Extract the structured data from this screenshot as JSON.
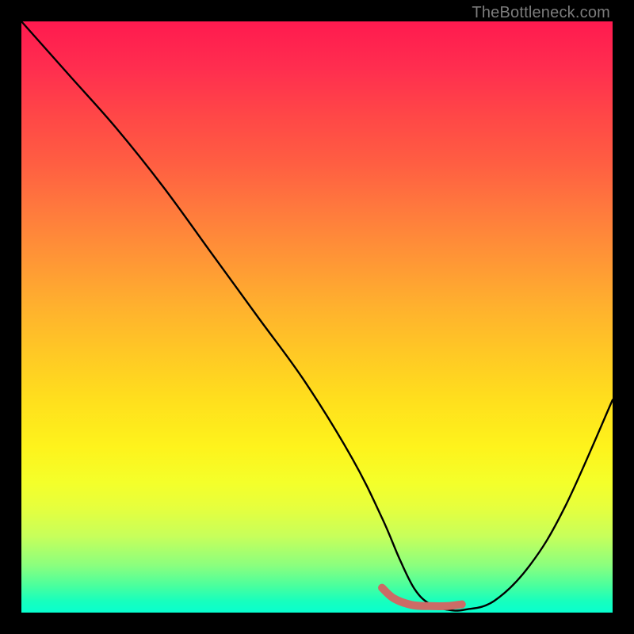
{
  "watermark": "TheBottleneck.com",
  "chart_data": {
    "type": "line",
    "title": "",
    "xlabel": "",
    "ylabel": "",
    "xlim": [
      0,
      100
    ],
    "ylim": [
      0,
      100
    ],
    "series": [
      {
        "name": "bottleneck-curve",
        "color": "#000000",
        "x": [
          0,
          8,
          16,
          24,
          32,
          40,
          48,
          56,
          61,
          64,
          66.5,
          69,
          72,
          75,
          80,
          86,
          92,
          100
        ],
        "values": [
          100,
          91,
          82,
          72,
          61,
          50,
          39,
          26,
          16,
          9,
          4,
          1.5,
          0.5,
          0.5,
          2,
          8,
          18,
          36
        ]
      },
      {
        "name": "optimal-range-marker",
        "color": "#cc6b66",
        "x": [
          61,
          63,
          66,
          69,
          72,
          74.5
        ],
        "values": [
          4.2,
          2.4,
          1.3,
          1.1,
          1.1,
          1.4
        ]
      }
    ],
    "gradient_stops": [
      {
        "pos": 0,
        "color": "#ff1a4f"
      },
      {
        "pos": 50,
        "color": "#ffb02e"
      },
      {
        "pos": 80,
        "color": "#f4ff2a"
      },
      {
        "pos": 100,
        "color": "#08ffce"
      }
    ]
  }
}
